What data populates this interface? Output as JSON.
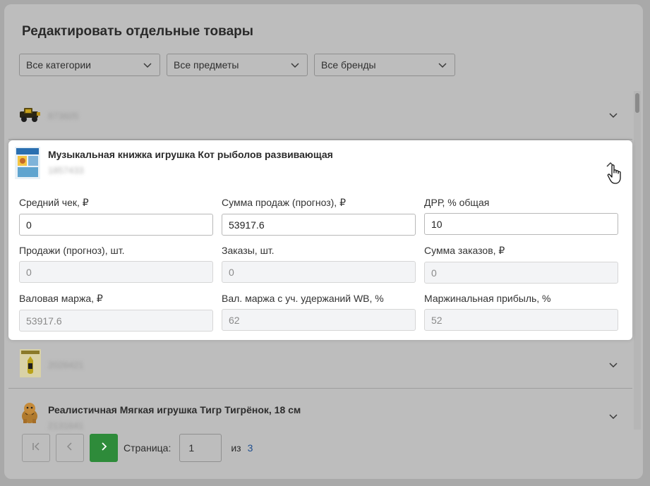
{
  "modal": {
    "title": "Редактировать отдельные товары"
  },
  "filters": {
    "category": "Все категории",
    "subject": "Все предметы",
    "brand": "Все бренды"
  },
  "rows": [
    {
      "name": "",
      "sku": "873605"
    },
    {
      "name": "",
      "sku": "2026421"
    },
    {
      "name": "Реалистичная Мягкая игрушка Тигр Тигрёнок, 18 см",
      "sku": "2131641"
    }
  ],
  "card": {
    "name": "Музыкальная книжка игрушка Кот рыболов развивающая",
    "sku": "1857433",
    "fields": [
      {
        "label": "Средний чек, ₽",
        "value": "0",
        "editable": true
      },
      {
        "label": "Сумма продаж (прогноз), ₽",
        "value": "53917.6",
        "editable": true
      },
      {
        "label": "ДРР, % общая",
        "value": "10",
        "editable": true
      },
      {
        "label": "Продажи (прогноз), шт.",
        "value": "0",
        "editable": false
      },
      {
        "label": "Заказы, шт.",
        "value": "0",
        "editable": false
      },
      {
        "label": "Сумма заказов, ₽",
        "value": "0",
        "editable": false
      },
      {
        "label": "Валовая маржа, ₽",
        "value": "53917.6",
        "editable": false
      },
      {
        "label": "Вал. маржа с уч. удержаний WB, %",
        "value": "62",
        "editable": false
      },
      {
        "label": "Маржинальная прибыль, %",
        "value": "52",
        "editable": false
      }
    ]
  },
  "pagination": {
    "page_label": "Страница:",
    "current_page": "1",
    "of_label": "из",
    "total_pages": "3"
  },
  "colors": {
    "accent_green": "#2e8b3a",
    "link_blue": "#1f4f8f"
  }
}
